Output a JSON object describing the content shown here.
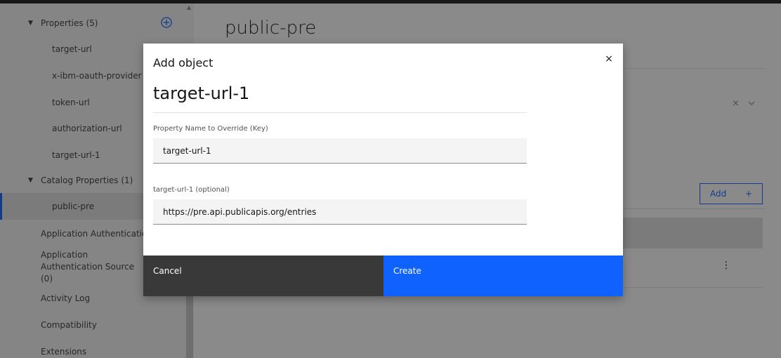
{
  "sidebar": {
    "properties_header": "Properties (5)",
    "properties": [
      "target-url",
      "x-ibm-oauth-provider",
      "token-url",
      "authorization-url",
      "target-url-1"
    ],
    "catalog_header": "Catalog Properties (1)",
    "catalog_items": [
      "public-pre"
    ],
    "sections": [
      "Application Authentication",
      "Application Authentication Source (0)",
      "Activity Log",
      "Compatibility",
      "Extensions"
    ],
    "add_icon": "plus-circle-icon"
  },
  "main": {
    "title": "public-pre",
    "add_button_label": "Add",
    "add_button_icon": "+",
    "clear_icon": "×",
    "dropdown_icon": "chevron-down-icon",
    "overflow_icon": "⋮"
  },
  "modal": {
    "label": "Add object",
    "heading": "target-url-1",
    "close_icon": "×",
    "key_label": "Property Name to Override (Key)",
    "key_value": "target-url-1",
    "value_label": "target-url-1 (optional)",
    "value_value": "https://pre.api.publicapis.org/entries",
    "cancel_label": "Cancel",
    "create_label": "Create"
  },
  "colors": {
    "primary": "#0f62fe",
    "secondary_button": "#393939",
    "overlay": "#161616"
  }
}
